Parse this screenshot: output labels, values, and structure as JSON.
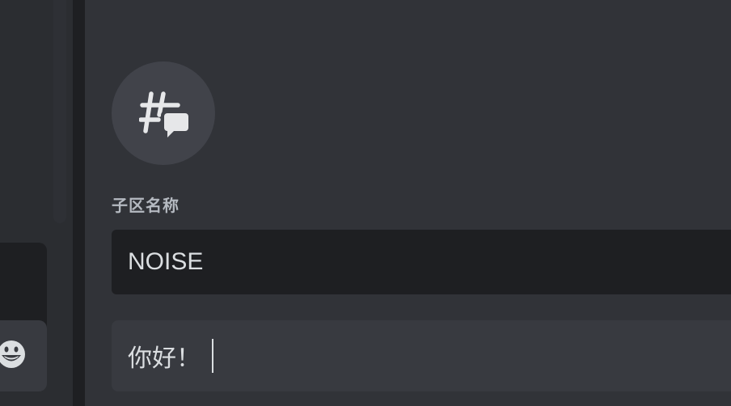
{
  "thread_form": {
    "icon": "thread-icon",
    "name_label": "子区名称",
    "name_value": "NOISE",
    "message_value": "你好！"
  },
  "left_pane": {
    "emoji_icon": "emoji-smile-icon"
  },
  "colors": {
    "background_main": "#313338",
    "background_side": "#2b2d31",
    "input_dark": "#1e1f22",
    "input_light": "#383a40",
    "text_primary": "#dbdee1",
    "text_label": "#b5bac1"
  }
}
